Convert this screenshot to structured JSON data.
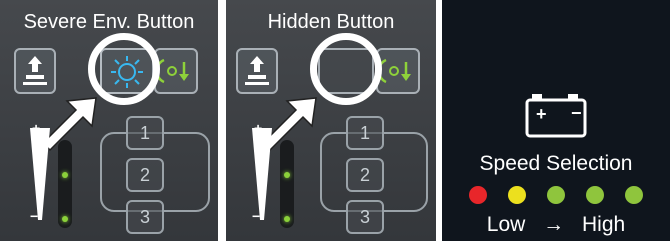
{
  "panels": [
    {
      "caption": "Severe Env. Button"
    },
    {
      "caption": "Hidden Button"
    }
  ],
  "buttons": {
    "lift_icon": "lift-arrow-icon",
    "severe_env_icon": "severe-environment-icon",
    "wheel_icon": "wheel-motion-icon"
  },
  "speed_buttons": [
    "1",
    "2",
    "3"
  ],
  "slider": {
    "plus": "+",
    "minus": "−"
  },
  "battery": {
    "plus": "+",
    "minus": "−"
  },
  "speed_selection": {
    "label": "Speed Selection",
    "low": "Low",
    "arrow": "→",
    "high": "High",
    "dots": [
      "#e8262a",
      "#ece01e",
      "#8fc53d",
      "#8fc53d",
      "#8fc53d"
    ]
  },
  "colors": {
    "severe_icon": "#38b8f0",
    "wheel_icon": "#8ed13a"
  }
}
